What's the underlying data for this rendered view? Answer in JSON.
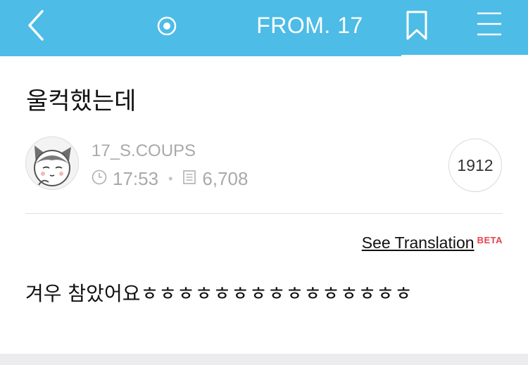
{
  "header": {
    "title": "FROM. 17",
    "icons": [
      "back-icon",
      "live-icon",
      "bookmark-icon",
      "menu-icon"
    ],
    "background_color": "#4dbce6"
  },
  "post": {
    "title": "울컥했는데",
    "author": "17_S.COUPS",
    "time": "17:53",
    "views": "6,708",
    "count_badge": "1912",
    "translation_link": "See Translation",
    "translation_badge": "BETA",
    "body": "겨우 참았어요ㅎㅎㅎㅎㅎㅎㅎㅎㅎㅎㅎㅎㅎㅎㅎ"
  }
}
